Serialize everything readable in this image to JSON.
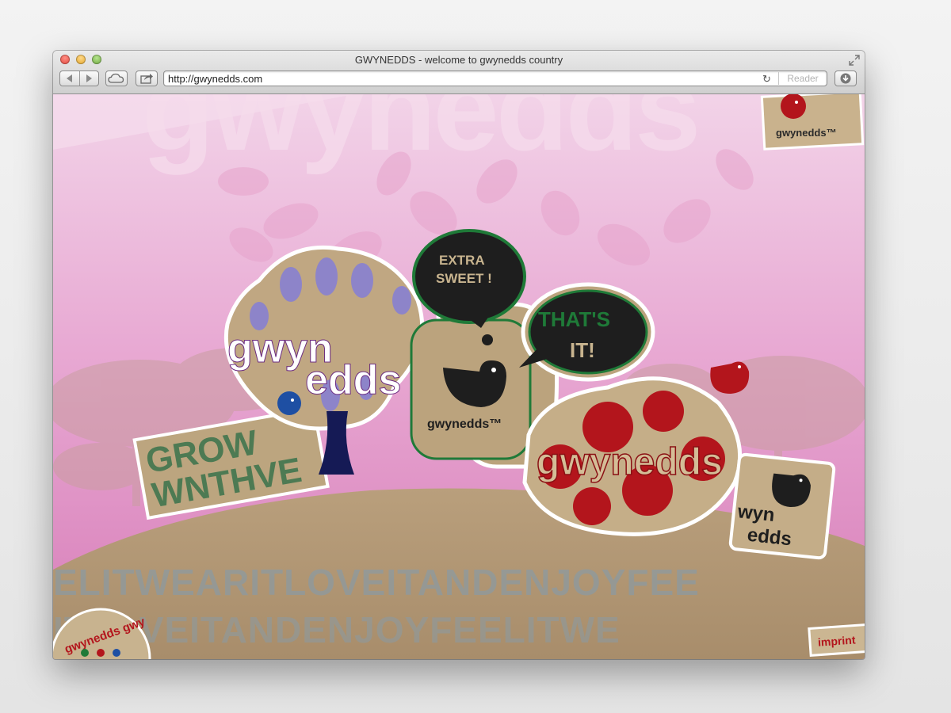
{
  "window": {
    "title": "GWYNEDDS - welcome to gwynedds country",
    "url": "http://gwynedds.com",
    "reader_label": "Reader"
  },
  "toolbar": {
    "icons": [
      "back-arrow-icon",
      "forward-arrow-icon",
      "icloud-tabs-icon",
      "share-icon",
      "reload-icon",
      "downloads-icon",
      "fullscreen-icon"
    ]
  },
  "page": {
    "bg_word": "gwynedds",
    "corner_brand": "gwynedds™",
    "tree_top": "gwyn",
    "tree_bottom": "edds",
    "grow_line1": "GROW",
    "grow_line2": "WNTHVE",
    "bubble1_line1": "EXTRA",
    "bubble1_line2": "SWEET !",
    "bubble2_line1": "THAT'S",
    "bubble2_line2": "IT!",
    "center_brand": "gwynedds™",
    "red_brand": "gwynedds",
    "small_sticker_top": "wyn",
    "small_sticker_bottom": "edds",
    "band1": "ELITWEARITLOVEITANDENJOYFEE",
    "band2": "ITLOVEITANDENJOYFEELITWE",
    "badge_text": "gwynedds gwy",
    "imprint": "imprint"
  },
  "colors": {
    "pink_top": "#f1cde4",
    "pink_bottom": "#de8bc1",
    "cardboard": "#bba17e",
    "purple": "#6b2b80",
    "lavender": "#8d84c9",
    "green": "#1f7a38",
    "red": "#b3151c",
    "dark": "#1e1e1e",
    "navy": "#151a55"
  }
}
